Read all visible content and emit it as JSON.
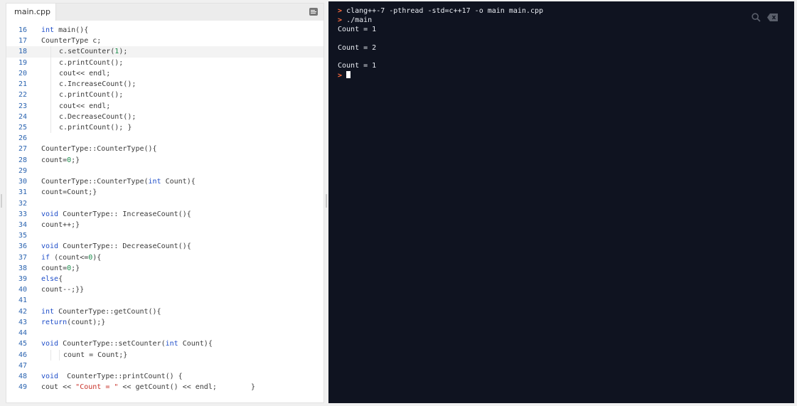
{
  "editor": {
    "tab_label": "main.cpp",
    "menu_icon": "menu-icon",
    "active_line": "18",
    "lines": [
      {
        "n": "16",
        "indent": 0,
        "parts": [
          {
            "t": "int",
            "c": "kw"
          },
          {
            "t": " main(){"
          }
        ]
      },
      {
        "n": "17",
        "indent": 0,
        "parts": [
          {
            "t": "CounterType c;"
          }
        ]
      },
      {
        "n": "18",
        "indent": 1,
        "parts": [
          {
            "t": "c.setCounter("
          },
          {
            "t": "1",
            "c": "num"
          },
          {
            "t": ");"
          }
        ]
      },
      {
        "n": "19",
        "indent": 1,
        "parts": [
          {
            "t": "c.printCount();"
          }
        ]
      },
      {
        "n": "20",
        "indent": 1,
        "parts": [
          {
            "t": "cout<< endl;"
          }
        ]
      },
      {
        "n": "21",
        "indent": 1,
        "parts": [
          {
            "t": "c.IncreaseCount();"
          }
        ]
      },
      {
        "n": "22",
        "indent": 1,
        "parts": [
          {
            "t": "c.printCount();"
          }
        ]
      },
      {
        "n": "23",
        "indent": 1,
        "parts": [
          {
            "t": "cout<< endl;"
          }
        ]
      },
      {
        "n": "24",
        "indent": 1,
        "parts": [
          {
            "t": "c.DecreaseCount();"
          }
        ]
      },
      {
        "n": "25",
        "indent": 1,
        "parts": [
          {
            "t": "c.printCount(); }"
          }
        ]
      },
      {
        "n": "26",
        "indent": 0,
        "parts": []
      },
      {
        "n": "27",
        "indent": 0,
        "parts": [
          {
            "t": "CounterType::CounterType(){"
          }
        ]
      },
      {
        "n": "28",
        "indent": 0,
        "parts": [
          {
            "t": "count="
          },
          {
            "t": "0",
            "c": "num"
          },
          {
            "t": ";}"
          }
        ]
      },
      {
        "n": "29",
        "indent": 0,
        "parts": []
      },
      {
        "n": "30",
        "indent": 0,
        "parts": [
          {
            "t": "CounterType::CounterType("
          },
          {
            "t": "int",
            "c": "kw"
          },
          {
            "t": " Count){"
          }
        ]
      },
      {
        "n": "31",
        "indent": 0,
        "parts": [
          {
            "t": "count=Count;}"
          }
        ]
      },
      {
        "n": "32",
        "indent": 0,
        "parts": []
      },
      {
        "n": "33",
        "indent": 0,
        "parts": [
          {
            "t": "void",
            "c": "kw"
          },
          {
            "t": " CounterType:: IncreaseCount(){"
          }
        ]
      },
      {
        "n": "34",
        "indent": 0,
        "parts": [
          {
            "t": "count++;}"
          }
        ]
      },
      {
        "n": "35",
        "indent": 0,
        "parts": []
      },
      {
        "n": "36",
        "indent": 0,
        "parts": [
          {
            "t": "void",
            "c": "kw"
          },
          {
            "t": " CounterType:: DecreaseCount(){"
          }
        ]
      },
      {
        "n": "37",
        "indent": 0,
        "parts": [
          {
            "t": "if",
            "c": "kw"
          },
          {
            "t": " (count<="
          },
          {
            "t": "0",
            "c": "num"
          },
          {
            "t": "){"
          }
        ]
      },
      {
        "n": "38",
        "indent": 0,
        "parts": [
          {
            "t": "count="
          },
          {
            "t": "0",
            "c": "num"
          },
          {
            "t": ";}"
          }
        ]
      },
      {
        "n": "39",
        "indent": 0,
        "parts": [
          {
            "t": "else",
            "c": "kw"
          },
          {
            "t": "{"
          }
        ]
      },
      {
        "n": "40",
        "indent": 0,
        "parts": [
          {
            "t": "count--;}}"
          }
        ]
      },
      {
        "n": "41",
        "indent": 0,
        "parts": []
      },
      {
        "n": "42",
        "indent": 0,
        "parts": [
          {
            "t": "int",
            "c": "kw"
          },
          {
            "t": " CounterType::getCount(){"
          }
        ]
      },
      {
        "n": "43",
        "indent": 0,
        "parts": [
          {
            "t": "return",
            "c": "kw"
          },
          {
            "t": "(count);}"
          }
        ]
      },
      {
        "n": "44",
        "indent": 0,
        "parts": []
      },
      {
        "n": "45",
        "indent": 0,
        "parts": [
          {
            "t": "void",
            "c": "kw"
          },
          {
            "t": " CounterType::setCounter("
          },
          {
            "t": "int",
            "c": "kw"
          },
          {
            "t": " Count){"
          }
        ]
      },
      {
        "n": "46",
        "indent": 2,
        "parts": [
          {
            "t": "count = Count;}"
          }
        ]
      },
      {
        "n": "47",
        "indent": 0,
        "parts": []
      },
      {
        "n": "48",
        "indent": 0,
        "parts": [
          {
            "t": "void",
            "c": "kw"
          },
          {
            "t": "  CounterType::printCount() {"
          }
        ]
      },
      {
        "n": "49",
        "indent": 0,
        "parts": [
          {
            "t": "cout << "
          },
          {
            "t": "\"Count = \"",
            "c": "str"
          },
          {
            "t": " << getCount() << endl;        }"
          }
        ]
      }
    ]
  },
  "terminal": {
    "search_icon": "search-icon",
    "clear_icon": "clear-icon",
    "lines": [
      {
        "prompt": true,
        "text": "clang++-7 -pthread -std=c++17 -o main main.cpp"
      },
      {
        "prompt": true,
        "text": "./main"
      },
      {
        "prompt": false,
        "text": "Count = 1"
      },
      {
        "prompt": false,
        "text": ""
      },
      {
        "prompt": false,
        "text": "Count = 2"
      },
      {
        "prompt": false,
        "text": ""
      },
      {
        "prompt": false,
        "text": "Count = 1"
      }
    ],
    "prompt_symbol": ">",
    "cursor_line": true
  },
  "colors": {
    "keyword": "#1f4ec9",
    "number": "#1a8c4a",
    "string": "#c8332b",
    "line_number": "#2a63b0",
    "prompt": "#ff6b3d",
    "terminal_bg": "#0f1320"
  }
}
